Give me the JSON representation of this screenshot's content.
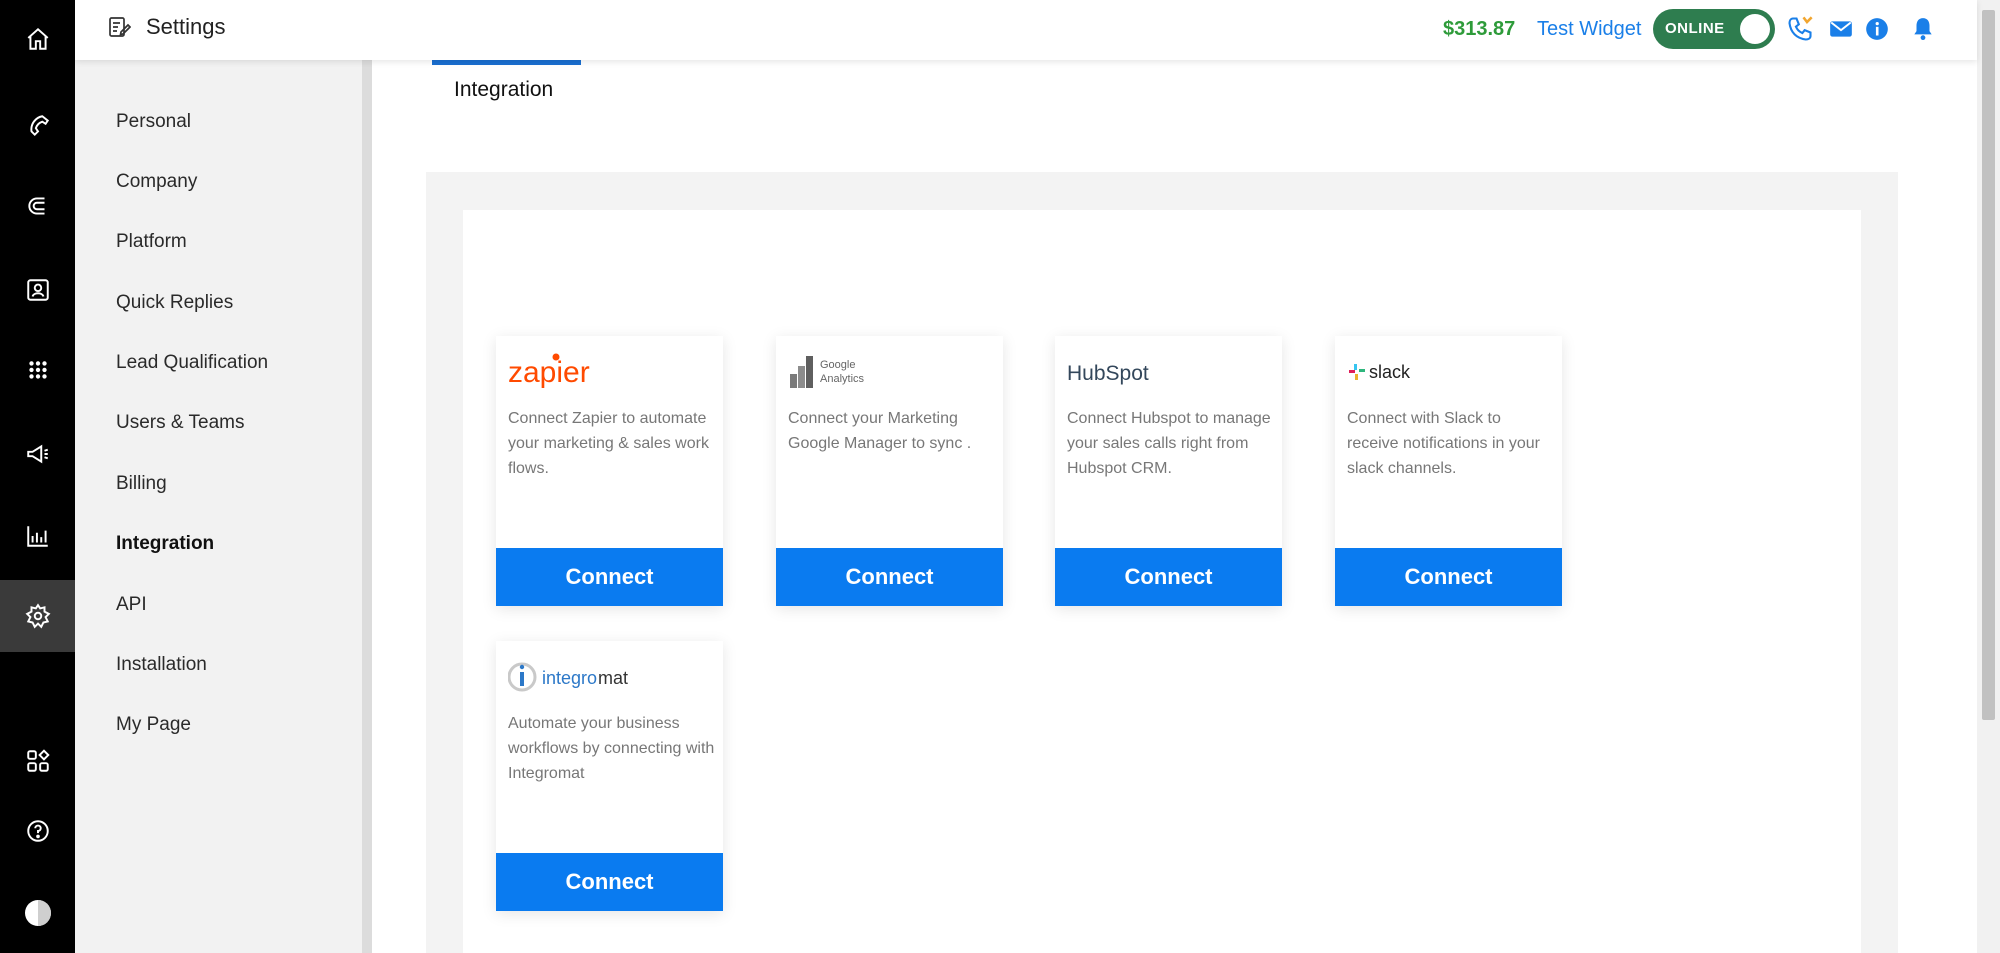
{
  "header": {
    "title": "Settings",
    "balance": "$313.87",
    "widget_name": "Test Widget",
    "status_label": "ONLINE"
  },
  "rail": {
    "icons": [
      "home-icon",
      "phone-icon",
      "magnet-icon",
      "contact-card-icon",
      "dialpad-icon",
      "megaphone-icon",
      "analytics-icon",
      "gear-icon",
      "apps-icon",
      "help-icon",
      "avatar"
    ]
  },
  "sidebar": {
    "items": [
      {
        "label": "Personal"
      },
      {
        "label": "Company"
      },
      {
        "label": "Platform"
      },
      {
        "label": "Quick Replies"
      },
      {
        "label": "Lead Qualification"
      },
      {
        "label": "Users & Teams"
      },
      {
        "label": "Billing"
      },
      {
        "label": "Integration"
      },
      {
        "label": "API"
      },
      {
        "label": "Installation"
      },
      {
        "label": "My Page"
      }
    ],
    "active": "Integration"
  },
  "main": {
    "tab_label": "Integration",
    "cards": [
      {
        "logo": "zapier",
        "logo_text": "zapier",
        "description": "Connect Zapier to automate your marketing & sales work flows.",
        "button": "Connect"
      },
      {
        "logo": "google-analytics",
        "logo_text_1": "Google",
        "logo_text_2": "Analytics",
        "description": "Connect your Marketing Google Manager to sync .",
        "button": "Connect"
      },
      {
        "logo": "hubspot",
        "logo_text": "HubSpot",
        "description": "Connect Hubspot to manage your sales calls right from Hubspot CRM.",
        "button": "Connect"
      },
      {
        "logo": "slack",
        "logo_text": "slack",
        "description": "Connect with Slack to receive notifications in your slack channels.",
        "button": "Connect"
      },
      {
        "logo": "integromat",
        "logo_text_1": "integro",
        "logo_text_2": "mat",
        "description": "Automate your business workflows by connecting with Integromat",
        "button": "Connect"
      }
    ]
  },
  "colors": {
    "accent": "#0a7bf0",
    "balance": "#2e9b3a",
    "link": "#1a7fe8",
    "online": "#2e7d4f",
    "zapier": "#ff4a00"
  }
}
